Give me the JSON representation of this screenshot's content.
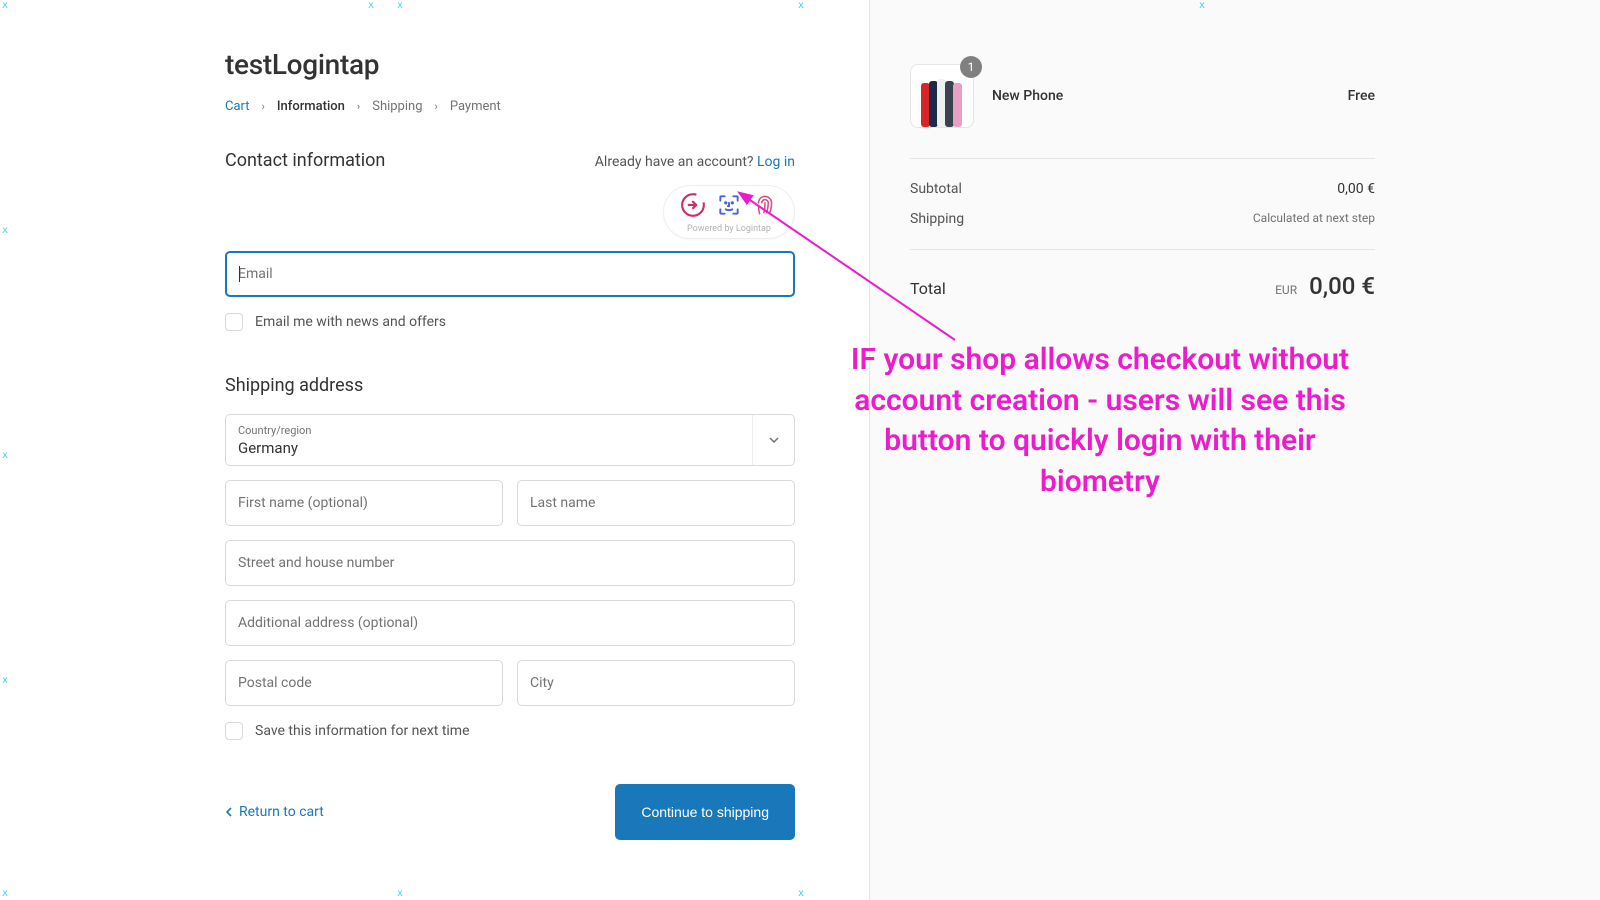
{
  "shop": {
    "title": "testLogintap"
  },
  "breadcrumb": {
    "cart": "Cart",
    "information": "Information",
    "shipping": "Shipping",
    "payment": "Payment"
  },
  "contact": {
    "heading": "Contact information",
    "already_text": "Already have an account? ",
    "login": "Log in",
    "email_placeholder": "Email",
    "news_checkbox": "Email me with news and offers",
    "biometry_caption": "Powered by Logintap"
  },
  "shipping_form": {
    "heading": "Shipping address",
    "country_label": "Country/region",
    "country_value": "Germany",
    "first_name_ph": "First name (optional)",
    "last_name_ph": "Last name",
    "street_ph": "Street and house number",
    "additional_ph": "Additional address (optional)",
    "postal_ph": "Postal code",
    "city_ph": "City",
    "save_checkbox": "Save this information for next time"
  },
  "footer": {
    "return": "Return to cart",
    "continue": "Continue to shipping"
  },
  "summary": {
    "item": {
      "name": "New Phone",
      "qty": "1",
      "price": "Free"
    },
    "subtotal_label": "Subtotal",
    "subtotal_value": "0,00 €",
    "shipping_label": "Shipping",
    "shipping_note": "Calculated at next step",
    "total_label": "Total",
    "currency": "EUR",
    "total_value": "0,00 €"
  },
  "annotation": {
    "text": "IF your shop allows checkout without account creation - users will see this button to quickly login with their biometry"
  },
  "colors": {
    "accent": "#1878b9",
    "magenta": "#ec1ccc"
  }
}
